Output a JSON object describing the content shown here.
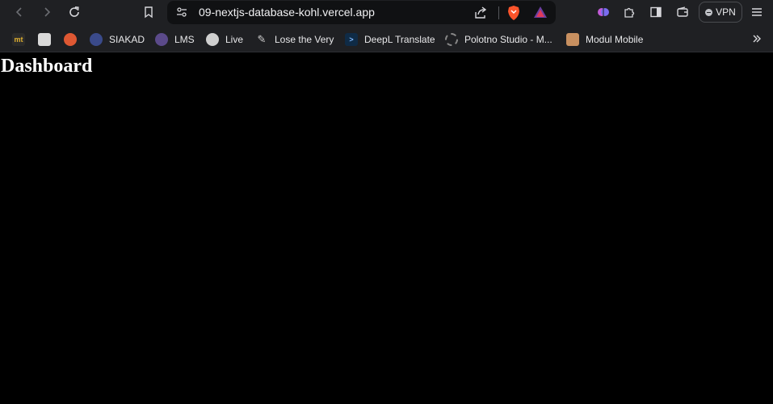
{
  "browser": {
    "url": "09-nextjs-database-kohl.vercel.app",
    "vpn_label": "VPN",
    "accent": "#fb542b"
  },
  "bookmarks": [
    {
      "label": "",
      "icon": "mt-icon",
      "color": "#2b2b2b"
    },
    {
      "label": "",
      "icon": "notes-icon",
      "color": "#d9d9d9"
    },
    {
      "label": "",
      "icon": "duckduckgo-icon",
      "color": "#de5833"
    },
    {
      "label": "SIAKAD",
      "icon": "university-seal-icon",
      "color": "#3a4a8a"
    },
    {
      "label": "LMS",
      "icon": "university-seal-icon",
      "color": "#5b4a8a"
    },
    {
      "label": "Live",
      "icon": "live-icon",
      "color": "#cfcfcf"
    },
    {
      "label": "Lose the Very",
      "icon": "pen-icon",
      "color": "#cfcfcf"
    },
    {
      "label": "DeepL Translate",
      "icon": "deepl-icon",
      "color": "#0f2b46"
    },
    {
      "label": "Polotno Studio - M...",
      "icon": "polotno-icon",
      "color": "#888888"
    },
    {
      "label": "Modul Mobile",
      "icon": "modul-icon",
      "color": "#c89060"
    }
  ],
  "page": {
    "title": "Dashboard"
  }
}
